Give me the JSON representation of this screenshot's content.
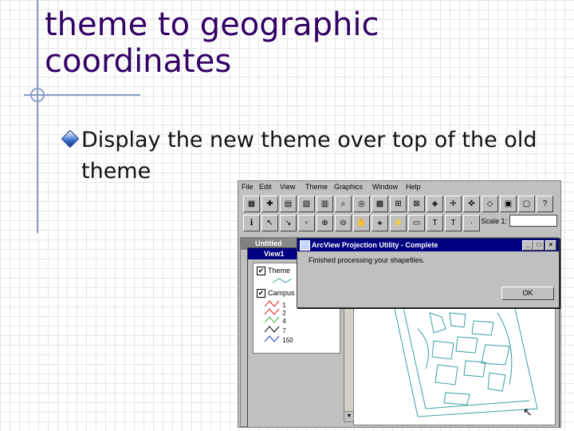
{
  "slide": {
    "title_line1": "theme to geographic",
    "title_line2": "coordinates",
    "bullet": "Display the new theme over top of the old theme"
  },
  "app": {
    "menu": [
      "File",
      "Edit",
      "View",
      "Theme",
      "Graphics",
      "Window",
      "Help"
    ],
    "scale_label": "Scale 1:",
    "outer_window_title": "Untitled",
    "view_window_title": "View1",
    "toc": {
      "theme1": "Theme",
      "theme2": "Campus",
      "legend_values": [
        "1",
        "2",
        "4",
        "7",
        "150"
      ]
    },
    "dialog": {
      "title": "ArcView Projection Utility - Complete",
      "message": "Finished processing your shapefiles.",
      "ok_label": "OK",
      "min_glyph": "_",
      "max_glyph": "□",
      "close_glyph": "×"
    }
  },
  "colors": {
    "title": "#330066",
    "titlebar_active": "#000080",
    "accent_line": "#8a9fc9",
    "map_lines": "#3aa0a0"
  }
}
